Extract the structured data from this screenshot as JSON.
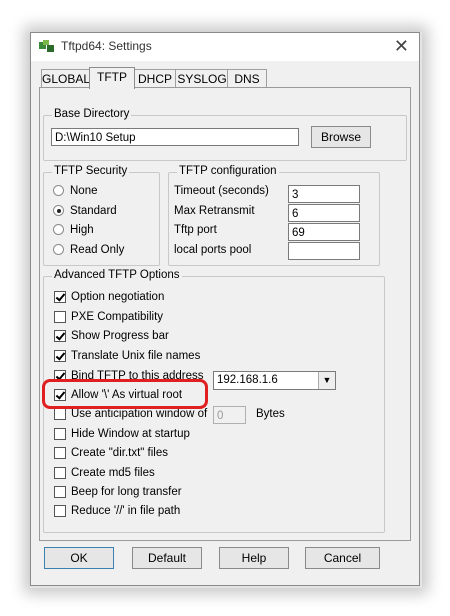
{
  "window": {
    "title": "Tftpd64: Settings",
    "close_glyph": "✕"
  },
  "tabs": [
    {
      "label": "GLOBAL"
    },
    {
      "label": "TFTP"
    },
    {
      "label": "DHCP"
    },
    {
      "label": "SYSLOG"
    },
    {
      "label": "DNS"
    }
  ],
  "active_tab": "TFTP",
  "base_directory": {
    "label": "Base Directory",
    "value": "D:\\Win10 Setup",
    "browse_label": "Browse"
  },
  "security": {
    "label": "TFTP Security",
    "options": [
      {
        "label": "None",
        "selected": false
      },
      {
        "label": "Standard",
        "selected": true
      },
      {
        "label": "High",
        "selected": false
      },
      {
        "label": "Read Only",
        "selected": false
      }
    ]
  },
  "configuration": {
    "label": "TFTP configuration",
    "fields": [
      {
        "label": "Timeout (seconds)",
        "value": "3"
      },
      {
        "label": "Max Retransmit",
        "value": "6"
      },
      {
        "label": "Tftp port",
        "value": "69"
      },
      {
        "label": "local ports pool",
        "value": ""
      }
    ]
  },
  "advanced": {
    "label": "Advanced TFTP Options",
    "options": [
      {
        "label": "Option negotiation",
        "checked": true
      },
      {
        "label": "PXE Compatibility",
        "checked": false
      },
      {
        "label": "Show Progress bar",
        "checked": true
      },
      {
        "label": "Translate Unix file names",
        "checked": true
      },
      {
        "label": "Bind TFTP to this address",
        "checked": true
      },
      {
        "label": "Allow '\\' As virtual root",
        "checked": true
      },
      {
        "label": "Use anticipation window of",
        "checked": false
      },
      {
        "label": "Hide Window at startup",
        "checked": false
      },
      {
        "label": "Create \"dir.txt\" files",
        "checked": false
      },
      {
        "label": "Create md5 files",
        "checked": false
      },
      {
        "label": "Beep for long transfer",
        "checked": false
      },
      {
        "label": "Reduce '//' in file path",
        "checked": false
      }
    ],
    "bind_address": "192.168.1.6",
    "anticipation_value": "0",
    "anticipation_unit": "Bytes"
  },
  "buttons": {
    "ok": "OK",
    "default": "Default",
    "help": "Help",
    "cancel": "Cancel"
  },
  "colors": {
    "highlight": "#e02020",
    "default_button_border": "#3c7fb1"
  },
  "icons": {
    "app": "tftpd-app-icon",
    "close": "close-icon"
  }
}
